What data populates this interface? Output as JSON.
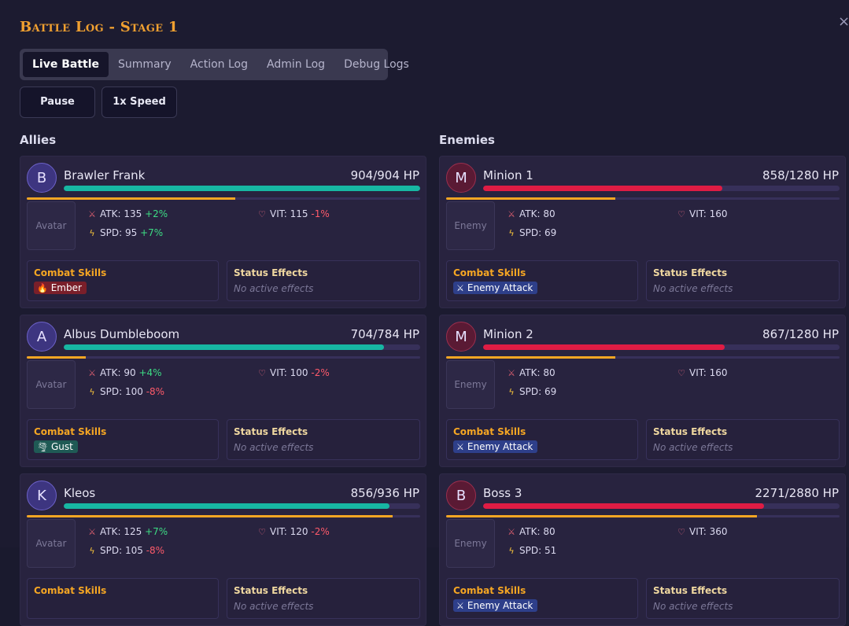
{
  "window": {
    "title": "Battle Log - Stage 1",
    "close_glyph": "×"
  },
  "tabs": [
    {
      "label": "Live Battle",
      "active": true
    },
    {
      "label": "Summary",
      "active": false
    },
    {
      "label": "Action Log",
      "active": false
    },
    {
      "label": "Admin Log",
      "active": false
    },
    {
      "label": "Debug Logs",
      "active": false
    }
  ],
  "controls": {
    "pause_label": "Pause",
    "speed_label": "1x Speed"
  },
  "labels": {
    "allies": "Allies",
    "enemies": "Enemies",
    "combat_skills": "Combat Skills",
    "status_effects": "Status Effects",
    "no_effects": "No active effects"
  },
  "colors": {
    "accent": "#f5a623",
    "ally_hp": "#17b7a3",
    "enemy_hp": "#df1c44",
    "positive": "#3ddc84",
    "negative": "#ff5a6a"
  },
  "allies": [
    {
      "initial": "B",
      "name": "Brawler Frank",
      "hp_text": "904/904 HP",
      "hp_fraction": 1.0,
      "energy_fraction": 0.53,
      "avatar_text": "Avatar",
      "atk": "ATK: 135",
      "atk_mod": "+2%",
      "vit": "VIT: 115",
      "vit_mod": "-1%",
      "spd": "SPD: 95",
      "spd_mod": "+7%",
      "skill": {
        "name": "Ember",
        "icon": "flame-icon",
        "glyph": "🔥"
      }
    },
    {
      "initial": "A",
      "name": "Albus Dumbleboom",
      "hp_text": "704/784 HP",
      "hp_fraction": 0.898,
      "energy_fraction": 0.15,
      "avatar_text": "Avatar",
      "atk": "ATK: 90",
      "atk_mod": "+4%",
      "vit": "VIT: 100",
      "vit_mod": "-2%",
      "spd": "SPD: 100",
      "spd_mod": "-8%",
      "skill": {
        "name": "Gust",
        "icon": "tornado-icon",
        "glyph": "🌪"
      }
    },
    {
      "initial": "K",
      "name": "Kleos",
      "hp_text": "856/936 HP",
      "hp_fraction": 0.915,
      "energy_fraction": 0.93,
      "avatar_text": "Avatar",
      "atk": "ATK: 125",
      "atk_mod": "+7%",
      "vit": "VIT: 120",
      "vit_mod": "-2%",
      "spd": "SPD: 105",
      "spd_mod": "-8%",
      "skill": {
        "name": "",
        "icon": "",
        "glyph": ""
      }
    }
  ],
  "enemies": [
    {
      "initial": "M",
      "name": "Minion 1",
      "hp_text": "858/1280 HP",
      "hp_fraction": 0.67,
      "energy_fraction": 0.43,
      "avatar_text": "Enemy",
      "atk": "ATK: 80",
      "vit": "VIT: 160",
      "spd": "SPD: 69",
      "skill": {
        "name": "Enemy Attack",
        "icon": "crossed-swords-icon",
        "glyph": "⚔"
      }
    },
    {
      "initial": "M",
      "name": "Minion 2",
      "hp_text": "867/1280 HP",
      "hp_fraction": 0.677,
      "energy_fraction": 0.43,
      "avatar_text": "Enemy",
      "atk": "ATK: 80",
      "vit": "VIT: 160",
      "spd": "SPD: 69",
      "skill": {
        "name": "Enemy Attack",
        "icon": "crossed-swords-icon",
        "glyph": "⚔"
      }
    },
    {
      "initial": "B",
      "name": "Boss 3",
      "hp_text": "2271/2880 HP",
      "hp_fraction": 0.789,
      "energy_fraction": 0.79,
      "avatar_text": "Enemy",
      "atk": "ATK: 80",
      "vit": "VIT: 360",
      "spd": "SPD: 51",
      "skill": {
        "name": "Enemy Attack",
        "icon": "crossed-swords-icon",
        "glyph": "⚔"
      }
    }
  ]
}
